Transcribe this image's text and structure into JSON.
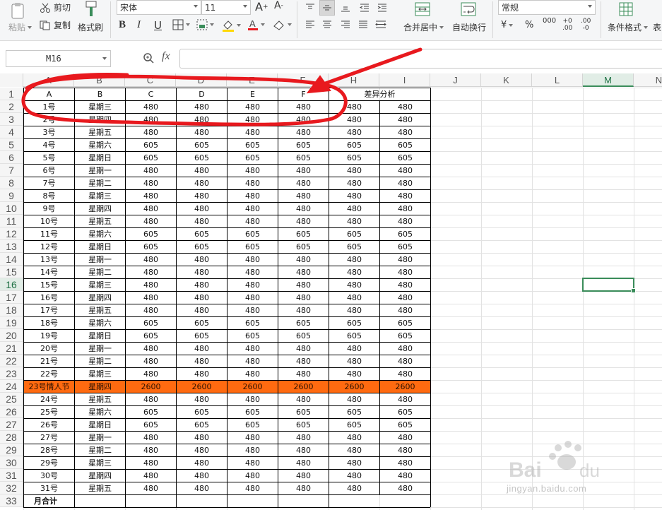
{
  "ribbon": {
    "paste_label": "粘贴",
    "cut_label": "剪切",
    "copy_label": "复制",
    "format_painter_label": "格式刷",
    "font_name": "宋体",
    "font_size": "11",
    "merge_center_label": "合并居中",
    "wrap_text_label": "自动换行",
    "number_format": "常规",
    "conditional_format_label": "条件格式",
    "more_label": "表"
  },
  "formula_bar": {
    "name_box": "M16",
    "fx_label": "fx",
    "formula": ""
  },
  "columns": [
    "A",
    "B",
    "C",
    "D",
    "E",
    "F",
    "H",
    "I",
    "J",
    "K",
    "L",
    "M",
    "N"
  ],
  "selected_column": "M",
  "selected_row": "16",
  "row_numbers": [
    "1",
    "2",
    "3",
    "4",
    "5",
    "6",
    "7",
    "8",
    "9",
    "10",
    "11",
    "12",
    "13",
    "14",
    "15",
    "16",
    "17",
    "18",
    "19",
    "20",
    "21",
    "22",
    "23",
    "24",
    "25",
    "26",
    "27",
    "28",
    "29",
    "30",
    "31",
    "32",
    "33"
  ],
  "header_row": [
    "A",
    "B",
    "C",
    "D",
    "E",
    "F"
  ],
  "merged_header": "差异分析",
  "rows": [
    [
      "1号",
      "星期三",
      "480",
      "480",
      "480",
      "480",
      "480",
      "480"
    ],
    [
      "2号",
      "星期四",
      "480",
      "480",
      "480",
      "480",
      "480",
      "480"
    ],
    [
      "3号",
      "星期五",
      "480",
      "480",
      "480",
      "480",
      "480",
      "480"
    ],
    [
      "4号",
      "星期六",
      "605",
      "605",
      "605",
      "605",
      "605",
      "605"
    ],
    [
      "5号",
      "星期日",
      "605",
      "605",
      "605",
      "605",
      "605",
      "605"
    ],
    [
      "6号",
      "星期一",
      "480",
      "480",
      "480",
      "480",
      "480",
      "480"
    ],
    [
      "7号",
      "星期二",
      "480",
      "480",
      "480",
      "480",
      "480",
      "480"
    ],
    [
      "8号",
      "星期三",
      "480",
      "480",
      "480",
      "480",
      "480",
      "480"
    ],
    [
      "9号",
      "星期四",
      "480",
      "480",
      "480",
      "480",
      "480",
      "480"
    ],
    [
      "10号",
      "星期五",
      "480",
      "480",
      "480",
      "480",
      "480",
      "480"
    ],
    [
      "11号",
      "星期六",
      "605",
      "605",
      "605",
      "605",
      "605",
      "605"
    ],
    [
      "12号",
      "星期日",
      "605",
      "605",
      "605",
      "605",
      "605",
      "605"
    ],
    [
      "13号",
      "星期一",
      "480",
      "480",
      "480",
      "480",
      "480",
      "480"
    ],
    [
      "14号",
      "星期二",
      "480",
      "480",
      "480",
      "480",
      "480",
      "480"
    ],
    [
      "15号",
      "星期三",
      "480",
      "480",
      "480",
      "480",
      "480",
      "480"
    ],
    [
      "16号",
      "星期四",
      "480",
      "480",
      "480",
      "480",
      "480",
      "480"
    ],
    [
      "17号",
      "星期五",
      "480",
      "480",
      "480",
      "480",
      "480",
      "480"
    ],
    [
      "18号",
      "星期六",
      "605",
      "605",
      "605",
      "605",
      "605",
      "605"
    ],
    [
      "19号",
      "星期日",
      "605",
      "605",
      "605",
      "605",
      "605",
      "605"
    ],
    [
      "20号",
      "星期一",
      "480",
      "480",
      "480",
      "480",
      "480",
      "480"
    ],
    [
      "21号",
      "星期二",
      "480",
      "480",
      "480",
      "480",
      "480",
      "480"
    ],
    [
      "22号",
      "星期三",
      "480",
      "480",
      "480",
      "480",
      "480",
      "480"
    ],
    [
      "23号情人节",
      "星期四",
      "2600",
      "2600",
      "2600",
      "2600",
      "2600",
      "2600"
    ],
    [
      "24号",
      "星期五",
      "480",
      "480",
      "480",
      "480",
      "480",
      "480"
    ],
    [
      "25号",
      "星期六",
      "605",
      "605",
      "605",
      "605",
      "605",
      "605"
    ],
    [
      "26号",
      "星期日",
      "605",
      "605",
      "605",
      "605",
      "605",
      "605"
    ],
    [
      "27号",
      "星期一",
      "480",
      "480",
      "480",
      "480",
      "480",
      "480"
    ],
    [
      "28号",
      "星期二",
      "480",
      "480",
      "480",
      "480",
      "480",
      "480"
    ],
    [
      "29号",
      "星期三",
      "480",
      "480",
      "480",
      "480",
      "480",
      "480"
    ],
    [
      "30号",
      "星期四",
      "480",
      "480",
      "480",
      "480",
      "480",
      "480"
    ],
    [
      "31号",
      "星期五",
      "480",
      "480",
      "480",
      "480",
      "480",
      "480"
    ]
  ],
  "highlight_row_index": 22,
  "highlight_color": "#ff6a10",
  "total_label": "月合计",
  "annotation": {
    "color": "#e8191e"
  },
  "watermark": {
    "text": "jingyan.baidu.com"
  }
}
